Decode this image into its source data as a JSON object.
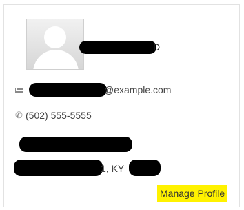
{
  "profile": {
    "name_suffix": "D",
    "email_suffix": "@example.com",
    "phone": "(502) 555-5555",
    "address_line2_suffix": "1, KY",
    "manage_label": "Manage Profile"
  },
  "icons": {
    "mail": "mail-icon",
    "phone": "phone-icon",
    "avatar": "user-avatar-placeholder"
  },
  "colors": {
    "highlight": "#fff200",
    "redaction": "#000000",
    "icon": "#8a8a8a",
    "text": "#444444"
  }
}
